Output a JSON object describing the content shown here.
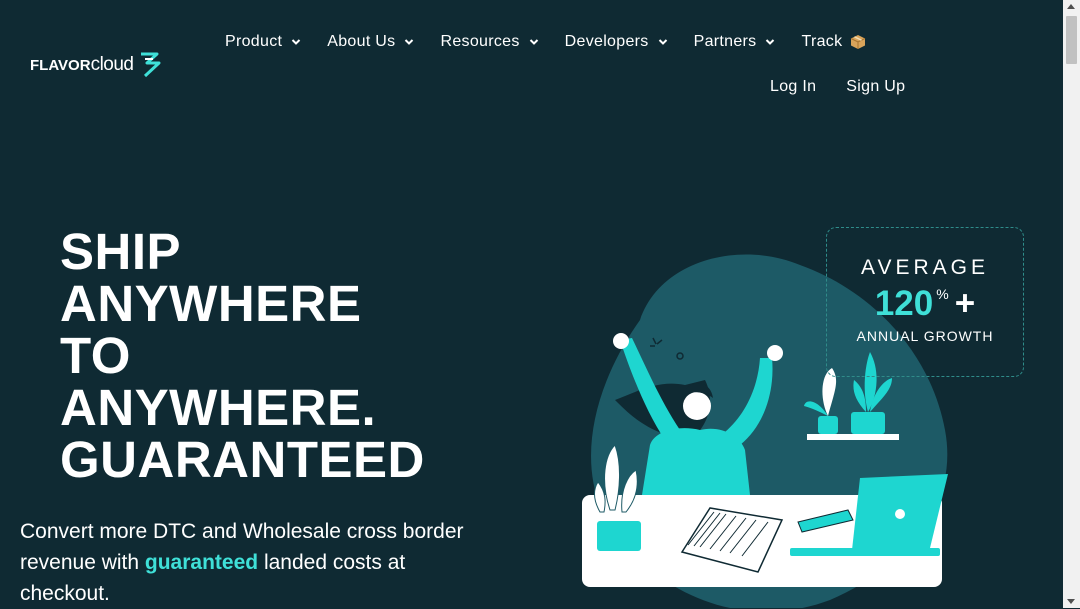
{
  "logo": {
    "bold": "FLAVOR",
    "light": "cloud"
  },
  "nav": {
    "items": [
      {
        "label": "Product"
      },
      {
        "label": "About Us"
      },
      {
        "label": "Resources"
      },
      {
        "label": "Developers"
      },
      {
        "label": "Partners"
      },
      {
        "label": "Track"
      }
    ],
    "login": "Log In",
    "signup": "Sign Up"
  },
  "hero": {
    "title_lines": [
      "SHIP",
      "ANYWHERE",
      "TO",
      "ANYWHERE.",
      "GUARANTEED"
    ],
    "sub_before": "Convert more DTC and Wholesale cross border revenue with ",
    "sub_highlight": "guaranteed",
    "sub_after": " landed costs at checkout."
  },
  "stat": {
    "heading": "AVERAGE",
    "number": "120",
    "percent": "%",
    "plus": "+",
    "label": "ANNUAL GROWTH"
  },
  "colors": {
    "background": "#0f2a33",
    "accent": "#3fe0d8",
    "blob": "#1d5a66"
  }
}
